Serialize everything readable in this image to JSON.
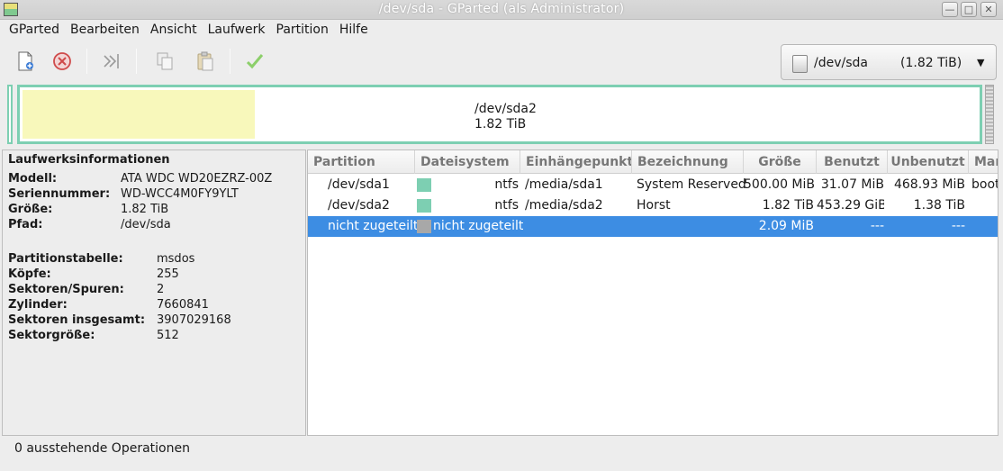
{
  "window": {
    "title": "/dev/sda - GParted (als Administrator)",
    "buttons": {
      "minimize": "—",
      "maximize": "□",
      "close": "✕"
    }
  },
  "menu": [
    "GParted",
    "Bearbeiten",
    "Ansicht",
    "Laufwerk",
    "Partition",
    "Hilfe"
  ],
  "toolbar": {
    "icons": [
      "new-partition-icon",
      "delete-icon",
      "resize-move-icon",
      "copy-icon",
      "paste-icon",
      "apply-icon"
    ],
    "device_selector": {
      "device": "/dev/sda",
      "size": "(1.82 TiB)",
      "arrow": "▼"
    }
  },
  "diskmap": {
    "label_name": "/dev/sda2",
    "label_size": "1.82 TiB",
    "colors": {
      "ntfs": "#7dcfb2",
      "used": "#f8f8bb",
      "unallocated": "#a8a8a8"
    }
  },
  "info": {
    "heading": "Laufwerksinformationen",
    "device": [
      {
        "key": "Modell:",
        "value": "ATA WDC WD20EZRZ-00Z"
      },
      {
        "key": "Seriennummer:",
        "value": "WD-WCC4M0FY9YLT"
      },
      {
        "key": "Größe:",
        "value": "1.82 TiB"
      },
      {
        "key": "Pfad:",
        "value": "/dev/sda"
      }
    ],
    "geometry": [
      {
        "key": "Partitionstabelle:",
        "value": "msdos"
      },
      {
        "key": "Köpfe:",
        "value": "255"
      },
      {
        "key": "Sektoren/Spuren:",
        "value": "2"
      },
      {
        "key": "Zylinder:",
        "value": "7660841"
      },
      {
        "key": "Sektoren insgesamt:",
        "value": "3907029168"
      },
      {
        "key": "Sektorgröße:",
        "value": "512"
      }
    ]
  },
  "table": {
    "headers": [
      "Partition",
      "Dateisystem",
      "Einhängepunkt",
      "Bezeichnung",
      "Größe",
      "Benutzt",
      "Unbenutzt",
      "Mar"
    ],
    "rows": [
      {
        "partition": "/dev/sda1",
        "fs": "ntfs",
        "fs_color": "#7dcfb2",
        "mount": "/media/sda1",
        "label": "System Reserved",
        "size": "500.00 MiB",
        "used": "31.07 MiB",
        "unused": "468.93 MiB",
        "flags": "boot"
      },
      {
        "partition": "/dev/sda2",
        "fs": "ntfs",
        "fs_color": "#7dcfb2",
        "mount": "/media/sda2",
        "label": "Horst",
        "size": "1.82 TiB",
        "used": "453.29 GiB",
        "unused": "1.38 TiB",
        "flags": ""
      },
      {
        "partition": "nicht zugeteilt",
        "fs": "nicht zugeteilt",
        "fs_color": "#a8a8a8",
        "mount": "",
        "label": "",
        "size": "2.09 MiB",
        "used": "---",
        "unused": "---",
        "flags": "",
        "selected": true
      }
    ]
  },
  "status": "0 ausstehende Operationen"
}
